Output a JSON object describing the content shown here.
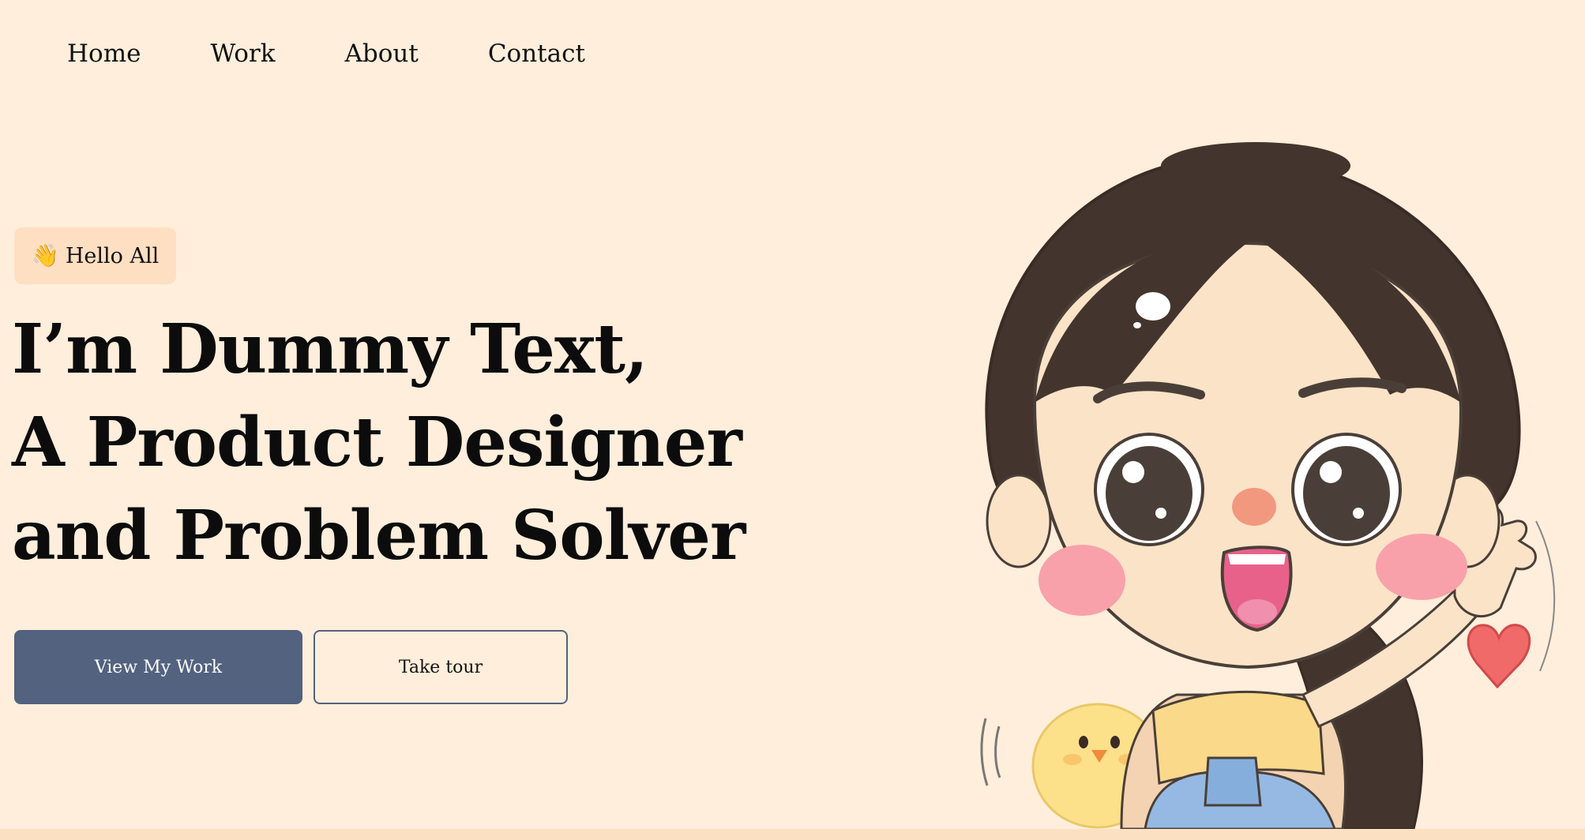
{
  "nav": {
    "items": [
      {
        "label": "Home"
      },
      {
        "label": "Work"
      },
      {
        "label": "About"
      },
      {
        "label": "Contact"
      }
    ]
  },
  "hero": {
    "greeting_emoji": "👋",
    "greeting_text": "Hello All",
    "headline_lines": [
      "I’m Dummy Text,",
      "A Product Designer",
      "and Problem Solver"
    ],
    "primary_button": "View My Work",
    "secondary_button": "Take tour"
  },
  "illustration": {
    "icon": "waving-girl-illustration"
  },
  "colors": {
    "background": "#FFEEDB",
    "badge_background": "#FFDFC2",
    "primary_button": "#52627F",
    "bottom_strip": "#FBE0C2"
  }
}
